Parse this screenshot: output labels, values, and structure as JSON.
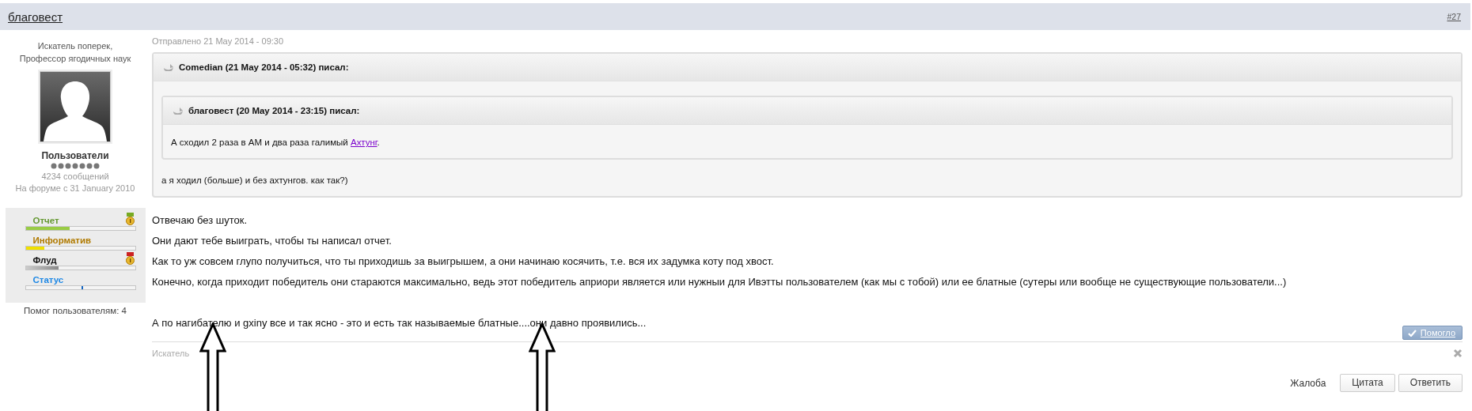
{
  "post": {
    "author": "благовест",
    "number": "#27",
    "date": "Отправлено 21 May 2014 - 09:30"
  },
  "user": {
    "titles": "Искатель поперек, Профессор ягодичных наук",
    "group": "Пользователи",
    "posts": "4234 сообщений",
    "joined": "На форуме с 31 January 2010",
    "helped": "Помог пользователям: 4",
    "reputation": [
      {
        "label": "Отчет",
        "color": "#669933",
        "kind": "bar",
        "level": 0.4,
        "medal": {
          "color": "#77aa22"
        }
      },
      {
        "label": "Информатив",
        "color": "#b07a00",
        "kind": "bar",
        "level": 0.17
      },
      {
        "label": "Флуд",
        "color": "#111111",
        "kind": "bar",
        "level": 0.3,
        "medal": {
          "color": "#cc2222"
        }
      },
      {
        "label": "Статус",
        "color": "#1e88e5",
        "kind": "marker",
        "level": 0.51
      }
    ]
  },
  "quote": {
    "header": "Comedian (21 May 2014 - 05:32) писал:",
    "nested": {
      "header": "благовест (20 May 2014 - 23:15) писал:",
      "text": "А сходил 2 раза в АМ и два раза галимый ",
      "link": "Ахтунг",
      "after": "."
    },
    "text": "а я ходил (больше) и без ахтунгов. как так?)"
  },
  "body": [
    [
      "Отвечаю без шуток.",
      "Они дают тебе выиграть, чтобы ты написал отчет.",
      "Как то уж совсем глупо получиться, что ты приходишь за выигрышем, а они начинаю косячить, т.е. вся их задумка коту под хвост.",
      "Конечно, когда приходит победитель они стараются максимально, ведь этот победитель априори является или нужныи для Ивэтты пользователем (как мы с тобой) или ее блатные (сутеры или вообще не существующие пользователи...)"
    ],
    [
      "А по нагибателю и gxiny все и так ясно - это и есть так называемые блатные....они давно проявились..."
    ]
  ],
  "helped_button": "Помогло",
  "signature": "Искатель",
  "actions": {
    "report": "Жалоба",
    "quote": "Цитата",
    "reply": "Ответить"
  }
}
